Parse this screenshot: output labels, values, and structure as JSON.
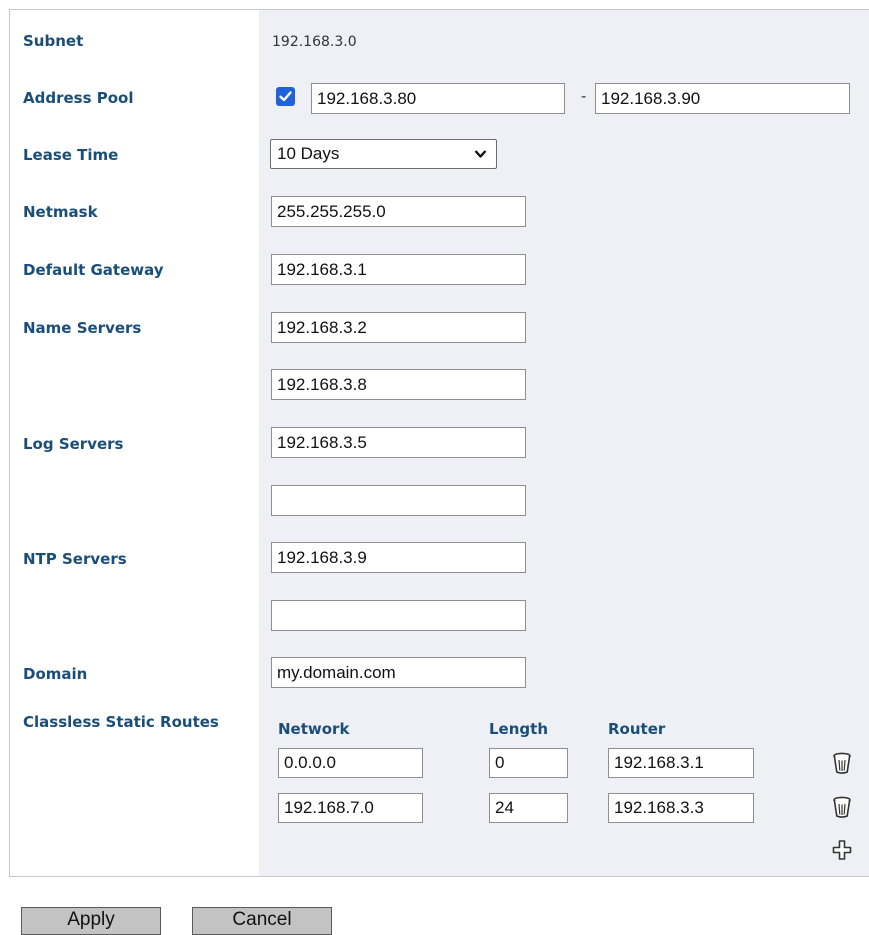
{
  "form": {
    "subnet": {
      "label": "Subnet",
      "value": "192.168.3.0"
    },
    "address_pool": {
      "label": "Address Pool",
      "enabled": true,
      "start": "192.168.3.80",
      "separator": "-",
      "end": "192.168.3.90"
    },
    "lease_time": {
      "label": "Lease Time",
      "selected": "10 Days"
    },
    "netmask": {
      "label": "Netmask",
      "value": "255.255.255.0"
    },
    "default_gateway": {
      "label": "Default Gateway",
      "value": "192.168.3.1"
    },
    "name_servers": {
      "label": "Name Servers",
      "values": [
        "192.168.3.2",
        "192.168.3.8"
      ]
    },
    "log_servers": {
      "label": "Log Servers",
      "values": [
        "192.168.3.5",
        ""
      ]
    },
    "ntp_servers": {
      "label": "NTP Servers",
      "values": [
        "192.168.3.9",
        ""
      ]
    },
    "domain": {
      "label": "Domain",
      "value": "my.domain.com"
    },
    "routes": {
      "label": "Classless Static Routes",
      "columns": {
        "network": "Network",
        "length": "Length",
        "router": "Router"
      },
      "rows": [
        {
          "network": "0.0.0.0",
          "length": "0",
          "router": "192.168.3.1"
        },
        {
          "network": "192.168.7.0",
          "length": "24",
          "router": "192.168.3.3"
        }
      ]
    }
  },
  "icons": {
    "delete": "trash-icon",
    "add": "plus-icon",
    "checkbox": "checkmark-icon",
    "dropdown": "chevron-down-icon"
  },
  "colors": {
    "label": "#1a4e79",
    "value_panel": "#eef0f6",
    "checkbox": "#1e63d7",
    "button": "#c3c3c3"
  },
  "actions": {
    "apply": "Apply",
    "cancel": "Cancel"
  }
}
